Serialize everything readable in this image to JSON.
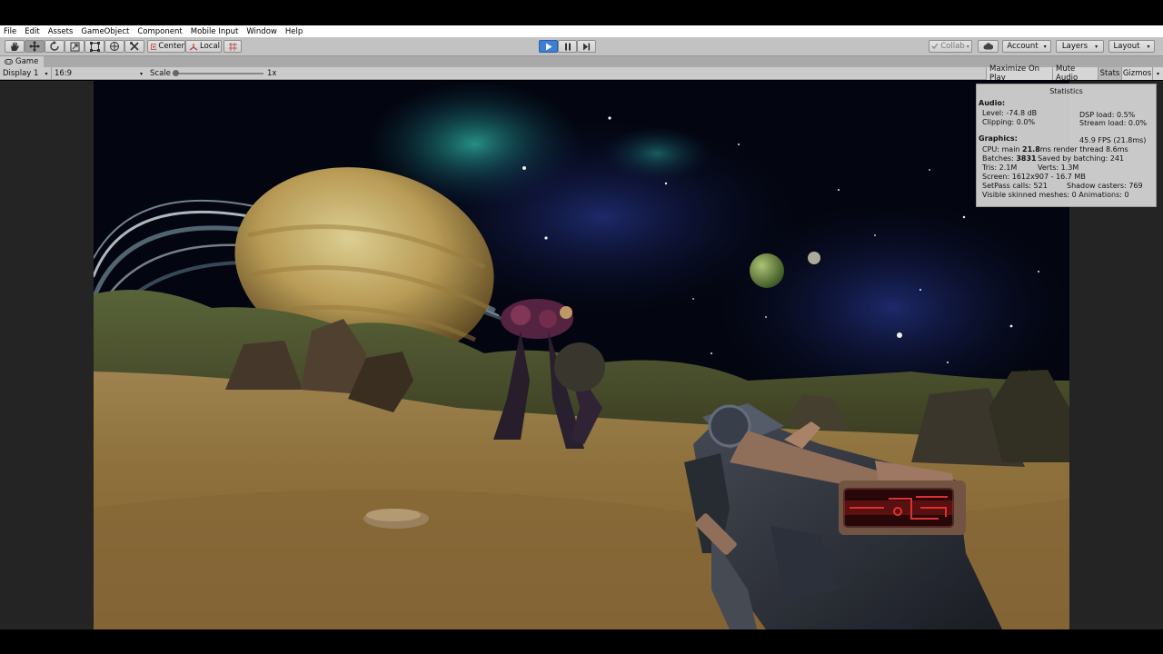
{
  "menu": [
    "File",
    "Edit",
    "Assets",
    "GameObject",
    "Component",
    "Mobile Input",
    "Window",
    "Help"
  ],
  "toolbar": {
    "tools": [
      "hand-icon",
      "move-icon",
      "rotate-icon",
      "scale-icon",
      "rect-icon",
      "transform-icon",
      "custom-tool-icon"
    ],
    "pivot_label": "Center",
    "space_label": "Local",
    "collab_label": "Collab",
    "account_label": "Account",
    "layers_label": "Layers",
    "layout_label": "Layout"
  },
  "tab": {
    "label": "Game"
  },
  "gamebar": {
    "display": "Display 1",
    "aspect": "16:9",
    "scale_label": "Scale",
    "scale_value": "1x",
    "scale_level": 0,
    "maximize": "Maximize On Play",
    "mute": "Mute Audio",
    "stats": "Stats",
    "gizmos": "Gizmos"
  },
  "stats": {
    "title": "Statistics",
    "audio_header": "Audio:",
    "level": "Level: -74.8 dB",
    "clipping": "Clipping: 0.0%",
    "dsp": "DSP load: 0.5%",
    "stream": "Stream load: 0.0%",
    "graphics_header": "Graphics:",
    "fps": "45.9 FPS (21.8ms)",
    "cpu_prefix": "CPU: main ",
    "cpu_main": "21.8",
    "cpu_suffix": "ms  render thread 8.6ms",
    "batches_prefix": "Batches: ",
    "batches": "3831",
    "saved": "Saved by batching: 241",
    "tris": "Tris: 2.1M",
    "verts": "Verts: 1.3M",
    "screen": "Screen: 1612x907 - 16.7 MB",
    "setpass": "SetPass calls: 521",
    "shadow": "Shadow casters: 769",
    "skinned": "Visible skinned meshes: 0  Animations: 0"
  },
  "colors": {
    "play_active": "#3d7fd4",
    "editor_gray": "#c2c2c2",
    "sky": "#050714",
    "sand": "#9c7a46"
  }
}
